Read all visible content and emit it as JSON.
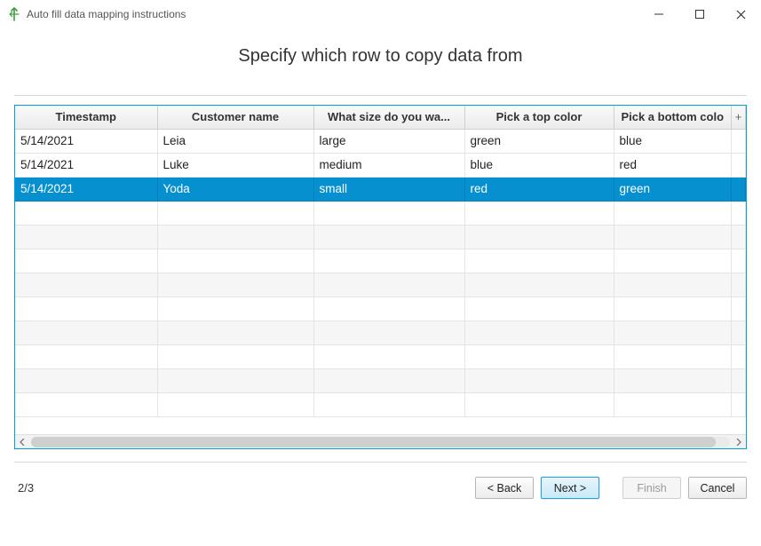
{
  "window": {
    "title": "Auto fill data mapping instructions"
  },
  "heading": "Specify which row to copy data from",
  "table": {
    "columns": [
      "Timestamp",
      "Customer name",
      "What size do you wa...",
      "Pick a top color",
      "Pick a bottom colo"
    ],
    "plus_header": "+",
    "rows": [
      {
        "cells": [
          "5/14/2021",
          "Leia",
          "large",
          "green",
          "blue"
        ],
        "selected": false
      },
      {
        "cells": [
          "5/14/2021",
          "Luke",
          "medium",
          "blue",
          "red"
        ],
        "selected": false
      },
      {
        "cells": [
          "5/14/2021",
          "Yoda",
          "small",
          "red",
          "green"
        ],
        "selected": true
      }
    ],
    "empty_row_count": 9
  },
  "footer": {
    "page_indicator": "2/3",
    "back_label": "< Back",
    "next_label": "Next >",
    "finish_label": "Finish",
    "cancel_label": "Cancel"
  }
}
